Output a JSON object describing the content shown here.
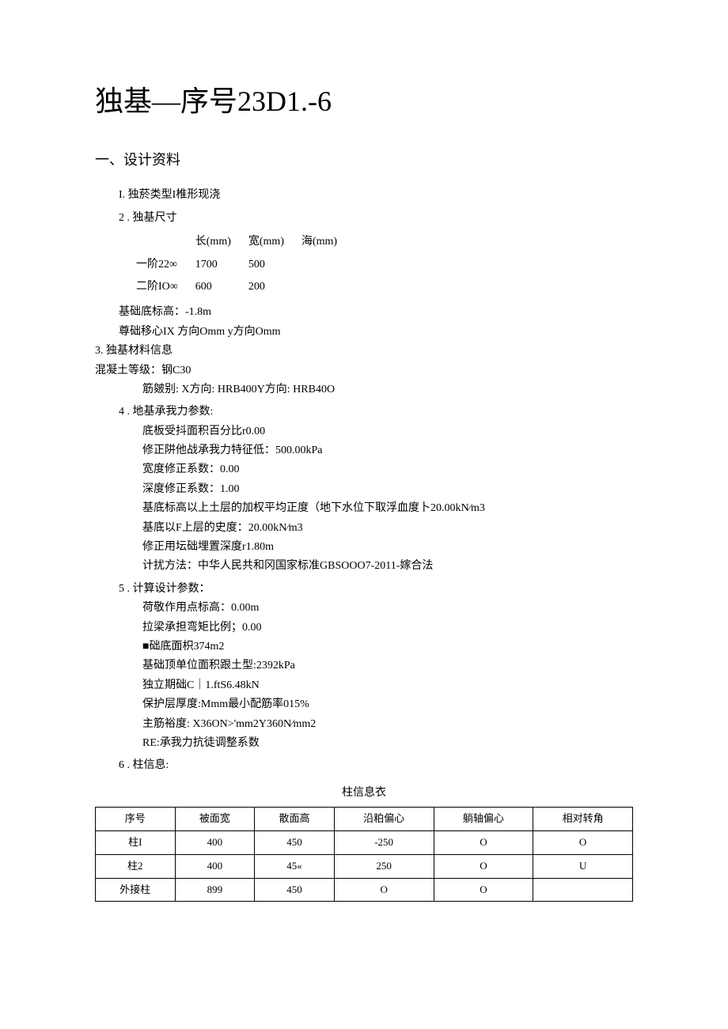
{
  "title": "独基—序号23D1.-6",
  "section1_title": "一、设计资料",
  "item1": "I. 独菸类型I椎形现浇",
  "item2_label": "2 . 独基尺寸",
  "dim_headers": {
    "h1": "长(mm)",
    "h2": "宽(mm)",
    "h3": "海(mm)"
  },
  "dim_rows": [
    {
      "label": "一阶22∞",
      "w": "1700",
      "h": "500"
    },
    {
      "label": "二阶IO∞",
      "w": "600",
      "h": "200"
    }
  ],
  "base_elev": "基础底标高：-1.8m",
  "offset": "尊础移心IX   方向Omm   y方向Omm",
  "item3_label": "3. 独基材料信息",
  "concrete_grade": "混凝土等级：钢C30",
  "rebar_spec": "筋皴别: X方向: HRB400Y方向: HRB40O",
  "item4_label": "4 . 地基承我力参数:",
  "item4_lines": [
    "底板受抖面积百分比r0.00",
    "修正阱他战承我力特征低：500.00kPa",
    "宽度修正系数：0.00",
    "深度修正系数：1.00",
    "基底标高以上土层的加权平均正度（地下水位下取浮血度卜20.00kN⁄m3",
    "基底以F上层的史度：20.00kN⁄m3",
    "修正用坛础埋置深度r1.80m",
    "计扰方法：中华人民共和冈国家标准GBSOOO7-2011-嫁合法"
  ],
  "item5_label": "5 . 计算设计参数：",
  "item5_lines": [
    "荷敬作用点标高：0.00m",
    "拉梁承担弯矩比例；0.00",
    "■础底面枳374m2",
    "基础顶单位面积跟土型:2392kPa",
    "独立期础C｜1.ftS6.48kN",
    "保护层厚度:Mmm最小配筋率015%",
    "主筋裕度: X36ON>'mm2Y360N⁄mm2",
    "RE:承我力抗徒调整系数"
  ],
  "item6_label": "6 . 柱信息:",
  "table_caption": "柱信息衣",
  "table_headers": [
    "序号",
    "被面宽",
    "散面高",
    "沿粕偏心",
    "躺轴偏心",
    "相对转角"
  ],
  "table_rows": [
    [
      "柱I",
      "400",
      "450",
      "-250",
      "O",
      "O"
    ],
    [
      "柱2",
      "400",
      "45«",
      "250",
      "O",
      "U"
    ],
    [
      "外接柱",
      "899",
      "450",
      "O",
      "O",
      ""
    ]
  ]
}
